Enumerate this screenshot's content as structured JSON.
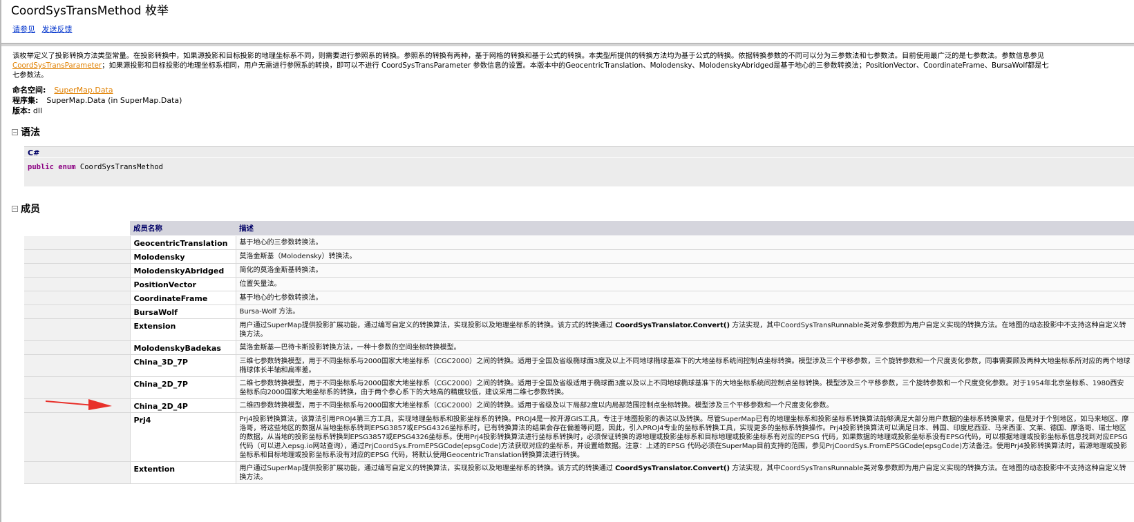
{
  "header": {
    "title": "CoordSysTransMethod 枚举",
    "links": [
      "请参见",
      "发送反馈"
    ]
  },
  "summary": {
    "line1": "该枚举定义了投影转换方法类型常量。在投影转换中，如果源投影和目标投影的地理坐标系不同，则需要进行参照系的转换。参照系的转换有两种，基于网格的转换和基于公式的转换。本类型所提供的转换方法均为基于公式的转换。依据转换参数的不同可以分为三参数法和七参数法。目前使用最广泛的是七参数法。参数信息参见",
    "link": "CoordSysTransParameter",
    "line2": "；如果源投影和目标投影的地理坐标系相同，用户无需进行参照系的转换，即可以不进行 CoordSysTransParameter 参数信息的设置。本版本中的GeocentricTranslation、Molodensky、MolodenskyAbridged是基于地心的三参数转换法；PositionVector、CoordinateFrame、BursaWolf都是七",
    "line3": "七参数法。"
  },
  "meta": {
    "namespace_label": "命名空间:",
    "namespace_value": "SuperMap.Data",
    "assembly_label": "程序集:",
    "assembly_value": "SuperMap.Data (in SuperMap.Data)",
    "version_label": "版本:",
    "version_value": "dll"
  },
  "syntax": {
    "heading": "语法",
    "lang": "C#",
    "kw1": "public",
    "kw2": "enum",
    "name": "CoordSysTransMethod"
  },
  "members": {
    "heading": "成员",
    "col_name": "成员名称",
    "col_desc": "描述",
    "rows": [
      {
        "name": "GeocentricTranslation",
        "desc": "基于地心的三参数转换法。"
      },
      {
        "name": "Molodensky",
        "desc": "莫洛金斯基（Molodensky）转换法。"
      },
      {
        "name": "MolodenskyAbridged",
        "desc": "简化的莫洛金斯基转换法。"
      },
      {
        "name": "PositionVector",
        "desc": "位置矢量法。"
      },
      {
        "name": "CoordinateFrame",
        "desc": "基于地心的七参数转换法。"
      },
      {
        "name": "BursaWolf",
        "desc": "Bursa-Wolf 方法。"
      },
      {
        "name": "Extension",
        "desc_a": "用户通过SuperMap提供投影扩展功能，通过编写自定义的转换算法，实现投影以及地理坐标系的转换。该方式的转换通过 ",
        "desc_b": "CoordSysTranslator.Convert()",
        "desc_c": " 方法实现，其中CoordSysTransRunnable类对象参数即为用户自定义实现的转换方法。在地图的动态投影中不支持这种自定义转换方法。"
      },
      {
        "name": "MolodenskyBadekas",
        "desc": "莫洛金斯基—巴待卡斯投影转换方法，一种十参数的空间坐标转换模型。"
      },
      {
        "name": "China_3D_7P",
        "desc": "三维七参数转换模型，用于不同坐标系与2000国家大地坐标系（CGC2000）之间的转换。适用于全国及省级椭球面3度及以上不同地球椭球基准下的大地坐标系统间控制点坐标转换。模型涉及三个平移参数，三个旋转参数和一个尺度变化参数，同事需要顾及两种大地坐标系所对应的两个地球椭球体长半轴和扁率差。"
      },
      {
        "name": "China_2D_7P",
        "desc": "二维七参数转换模型，用于不同坐标系与2000国家大地坐标系（CGC2000）之间的转换。适用于全国及省级适用于椭球面3度以及以上不同地球椭球基准下的大地坐标系统间控制点坐标转换。模型涉及三个平移参数，三个旋转参数和一个尺度变化参数。对于1954年北京坐标系、1980西安坐标系向2000国家大地坐标系的转换，由于两个参心系下的大地高的精度较低，建议采用二维七参数转换。"
      },
      {
        "name": "China_2D_4P",
        "desc": "二维四参数转换模型，用于不同坐标系与2000国家大地坐标系（CGC2000）之间的转换。适用于省级及以下局部2度以内局部范围控制点坐标转换。模型涉及三个平移参数和一个尺度变化参数。"
      },
      {
        "name": "Prj4",
        "desc": "Prj4投影转换算法，该算法引用PROJ4第三方工具，实现地理坐标系和投影坐标系的转换。PROJ4是一款开源GIS工具，专注于地图投影的表达以及转换。尽管SuperMap已有的地理坐标系和投影坐标系转换算法能够满足大部分用户数据的坐标系转换需求，但是对于个别地区，如马来地区、摩洛哥，将这些地区的数据从当地坐标系转到EPSG3857或EPSG4326坐标系时，已有转换算法的结果会存在偏差等问题，因此，引入PROJ4专业的坐标系转换工具，实现更多的坐标系转换操作。Prj4投影转换算法可以满足日本、韩国、印度尼西亚、马来西亚、文莱、德国、摩洛哥、瑞士地区的数据，从当地的投影坐标系转换到EPSG3857或EPSG4326坐标系。使用Prj4投影转换算法进行坐标系转换时，必须保证转换的源地理或投影坐标系和目标地理或投影坐标系有对应的EPSG 代码，如果数据的地理或投影坐标系没有EPSG代码，可以根据地理或投影坐标系信息找到对应EPSG 代码（可以进入epsg.io网站查询），通过PrjCoordSys.FromEPSGCode(epsgCode)方法获取对应的坐标系，并设置给数据。注意：上述的EPSG 代码必须在SuperMap目前支持的范围，参见PrjCoordSys.FromEPSGCode(epsgCode)方法备注。使用Prj4投影转换算法时，若源地理或投影坐标系和目标地理或投影坐标系没有对应的EPSG 代码，将默认使用GeocentricTranslation转换算法进行转换。"
      },
      {
        "name": "Extention",
        "desc_a": "用户通过SuperMap提供投影扩展功能，通过编写自定义的转换算法，实现投影以及地理坐标系的转换。该方式的转换通过 ",
        "desc_b": "CoordSysTranslator.Convert()",
        "desc_c": " 方法实现，其中CoordSysTransRunnable类对象参数即为用户自定义实现的转换方法。在地图的动态投影中不支持这种自定义转换方法。"
      }
    ]
  },
  "colors": {
    "link_blue": "#0033cc",
    "link_orange": "#e08000",
    "table_header_bg": "#d5d5dd",
    "arrow_red": "#e8302a"
  }
}
